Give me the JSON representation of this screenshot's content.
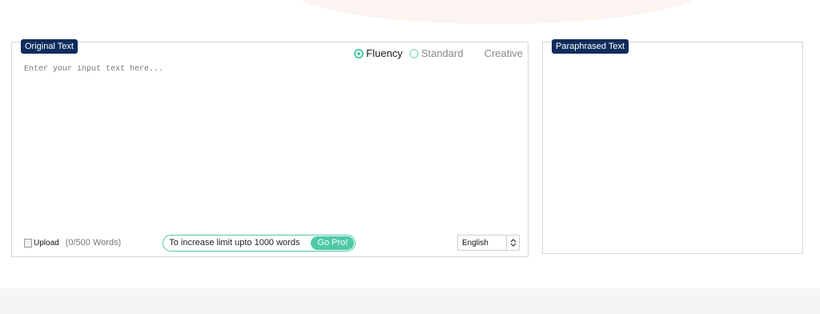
{
  "original": {
    "tag_label": "Original Text",
    "modes": [
      {
        "label": "Fluency",
        "selected": true
      },
      {
        "label": "Standard",
        "selected": false
      }
    ],
    "creative_label": "Creative",
    "input_placeholder": "Enter your input text here...",
    "upload_label": "Upload",
    "word_count": "(0/500 Words)",
    "promo_text": "To increase limit upto 1000 words",
    "go_pro_label": "Go Pro!",
    "language": "English"
  },
  "paraphrased": {
    "tag_label": "Paraphrased Text"
  },
  "colors": {
    "accent": "#4fc9a7",
    "tag_bg": "#0f2c5c"
  }
}
